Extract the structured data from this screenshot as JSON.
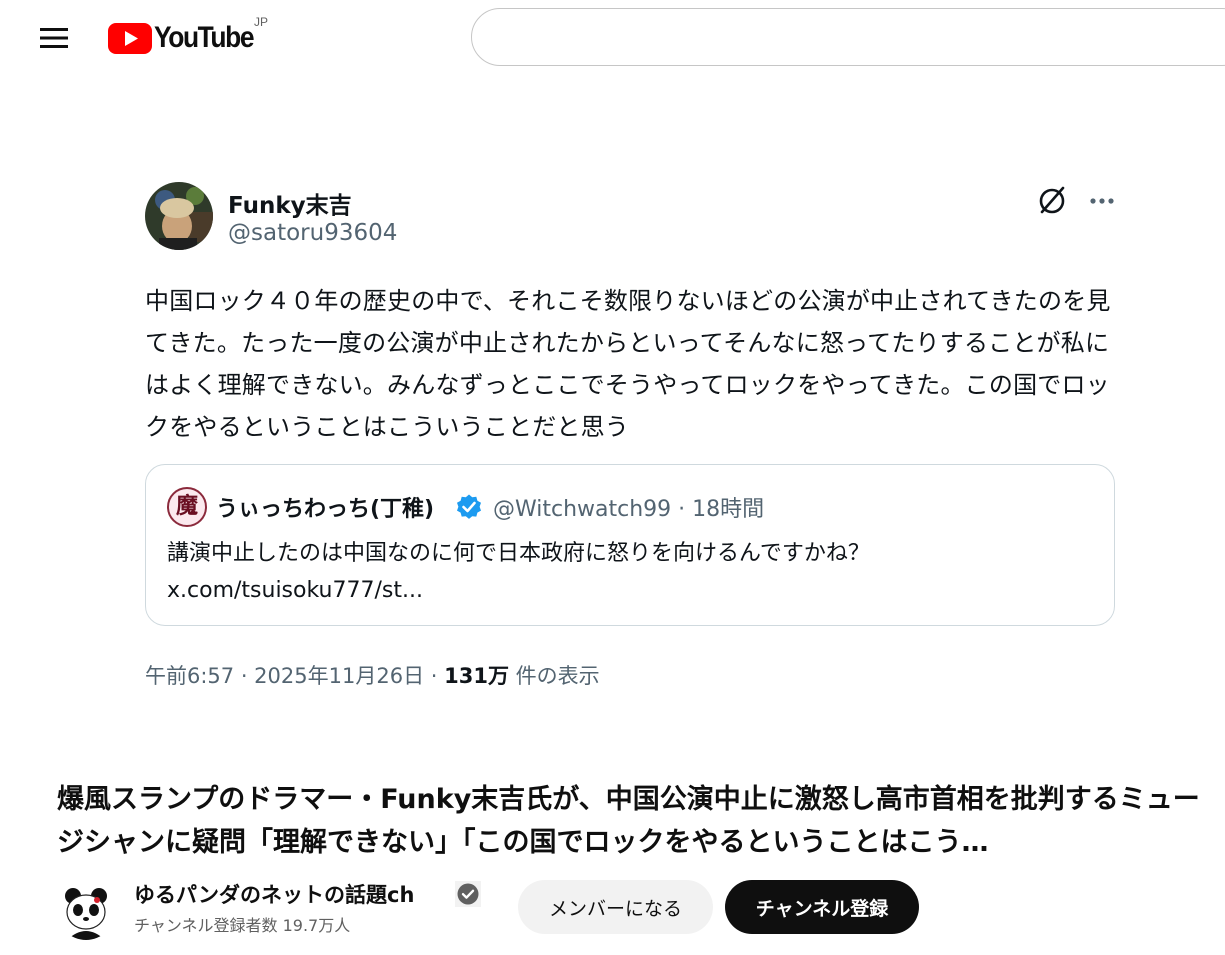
{
  "header": {
    "menu_icon": "hamburger-menu-icon",
    "logo_text": "YouTube",
    "logo_region": "JP",
    "brand_color": "#ff0000",
    "search": {
      "value": ""
    }
  },
  "tweet": {
    "author_name": "Funky末吉",
    "author_handle": "@satoru93604",
    "icons": [
      "grok-icon",
      "more-options-icon"
    ],
    "body": "中国ロック４０年の歴史の中で、それこそ数限りないほどの公演が中止されてきたのを見てきた。たった一度の公演が中止されたからといってそんなに怒ってたりすることが私にはよく理解できない。みんなずっとここでそうやってロックをやってきた。この国でロックをやるということはこういうことだと思う",
    "quote": {
      "avatar_char": "魔",
      "name": "うぃっちわっち(丁稚)",
      "handle_time": "@Witchwatch99 · 18時間",
      "text": "講演中止したのは中国なのに何で日本政府に怒りを向けるんですかね？",
      "link": "x.com/tsuisoku777/st...",
      "verified_color": "#1d9bf0"
    },
    "meta": {
      "time_date": "午前6:57 · 2025年11月26日 · ",
      "views": "131万",
      "views_label": "件の表示"
    }
  },
  "video": {
    "title": "爆風スランプのドラマー・Funky末吉氏が、中国公演中止に激怒し高市首相を批判するミュージシャンに疑問「理解できない」「この国でロックをやるということはこう…"
  },
  "channel": {
    "name": "ゆるパンダのネットの話題ch",
    "subscribers": "チャンネル登録者数 19.7万人",
    "member_button": "メンバーになる",
    "subscribe_button": "チャンネル登録"
  }
}
